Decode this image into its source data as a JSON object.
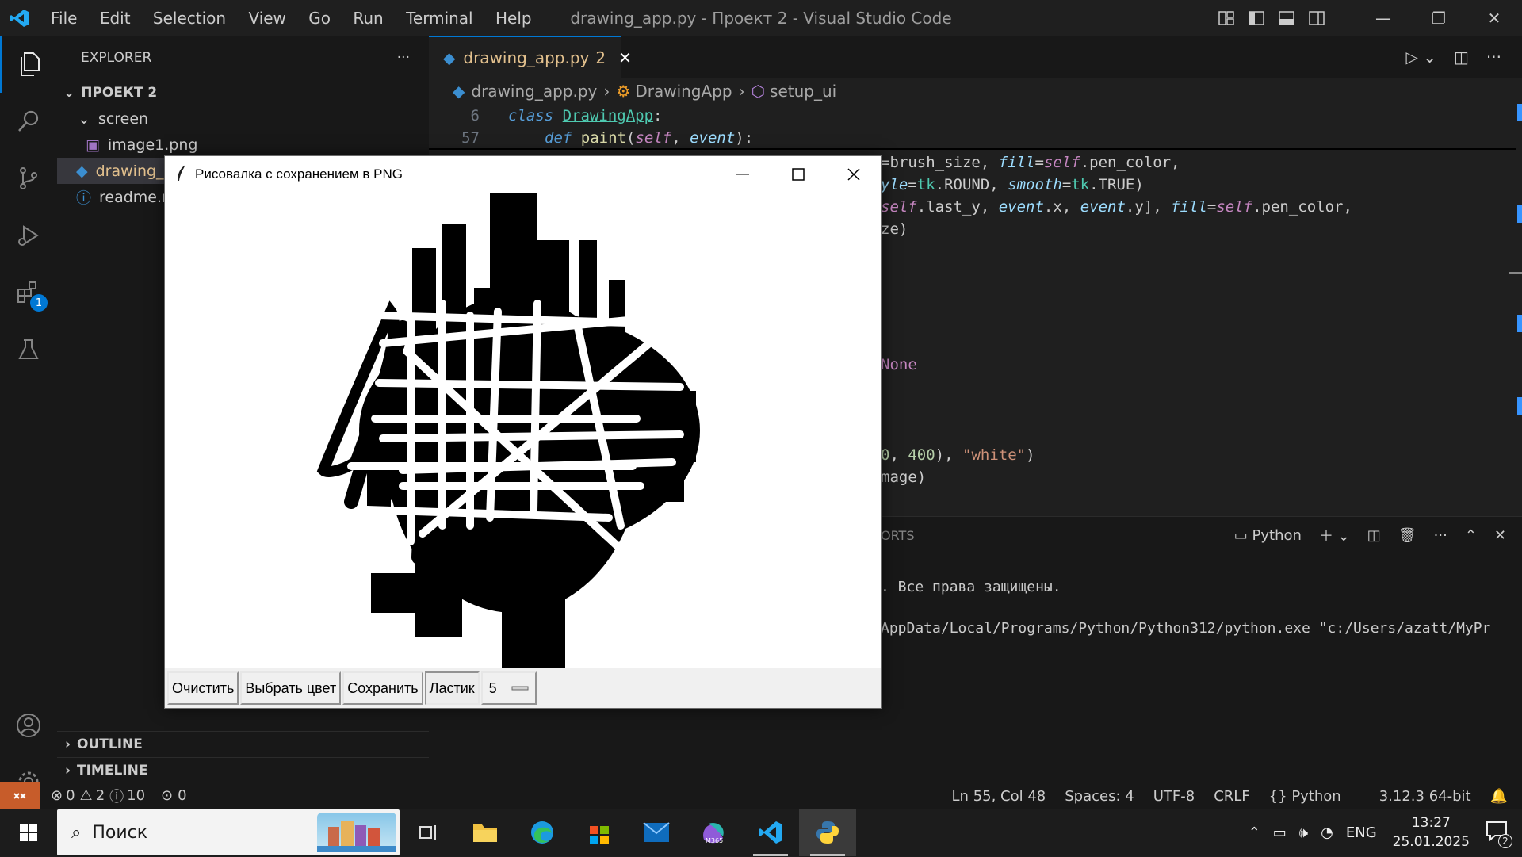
{
  "window": {
    "title": "drawing_app.py - Проект 2 - Visual Studio Code"
  },
  "menu": [
    "File",
    "Edit",
    "Selection",
    "View",
    "Go",
    "Run",
    "Terminal",
    "Help"
  ],
  "activity": {
    "extensions_badge": "1"
  },
  "sidebar": {
    "title": "EXPLORER",
    "more": "···",
    "project": "ПРОЕКТ 2",
    "folder": "screen",
    "files": [
      "image1.png",
      "drawing_a",
      "readme.m"
    ],
    "outline": "OUTLINE",
    "timeline": "TIMELINE"
  },
  "editor": {
    "tab_label": "drawing_app.py",
    "tab_badge": "2",
    "breadcrumb": [
      "drawing_app.py",
      "DrawingApp",
      "setup_ui"
    ],
    "sticky": [
      {
        "num": "6",
        "text": "class DrawingApp:"
      },
      {
        "num": "57",
        "text": "def paint(self, event):"
      }
    ],
    "visible_code": [
      "=brush_size, fill=self.pen_color,",
      "yle=tk.ROUND, smooth=tk.TRUE)",
      "self.last_y, event.x, event.y], fill=self.pen_color,",
      "ze)",
      "None",
      "0, 400), \"white\")",
      "mage)"
    ]
  },
  "panel": {
    "tab_fragment": "ORTS",
    "terminal_name": "Python",
    "lines": [
      ". Все права защищены.",
      "AppData/Local/Programs/Python/Python312/python.exe \"c:/Users/azatt/MyPr"
    ]
  },
  "status": {
    "errors": "0",
    "warnings": "2",
    "infos": "10",
    "ports": "0",
    "position": "Ln 55, Col 48",
    "spaces": "Spaces: 4",
    "encoding": "UTF-8",
    "eol": "CRLF",
    "language": "Python",
    "interpreter": "3.12.3 64-bit"
  },
  "tk_app": {
    "title": "Рисовалка с сохранением в PNG",
    "buttons": [
      "Очистить",
      "Выбрать цвет",
      "Сохранить",
      "Ластик"
    ],
    "brush_size": "5"
  },
  "taskbar": {
    "search_placeholder": "Поиск",
    "lang": "ENG",
    "time": "13:27",
    "date": "25.01.2025",
    "notifications": "2"
  }
}
